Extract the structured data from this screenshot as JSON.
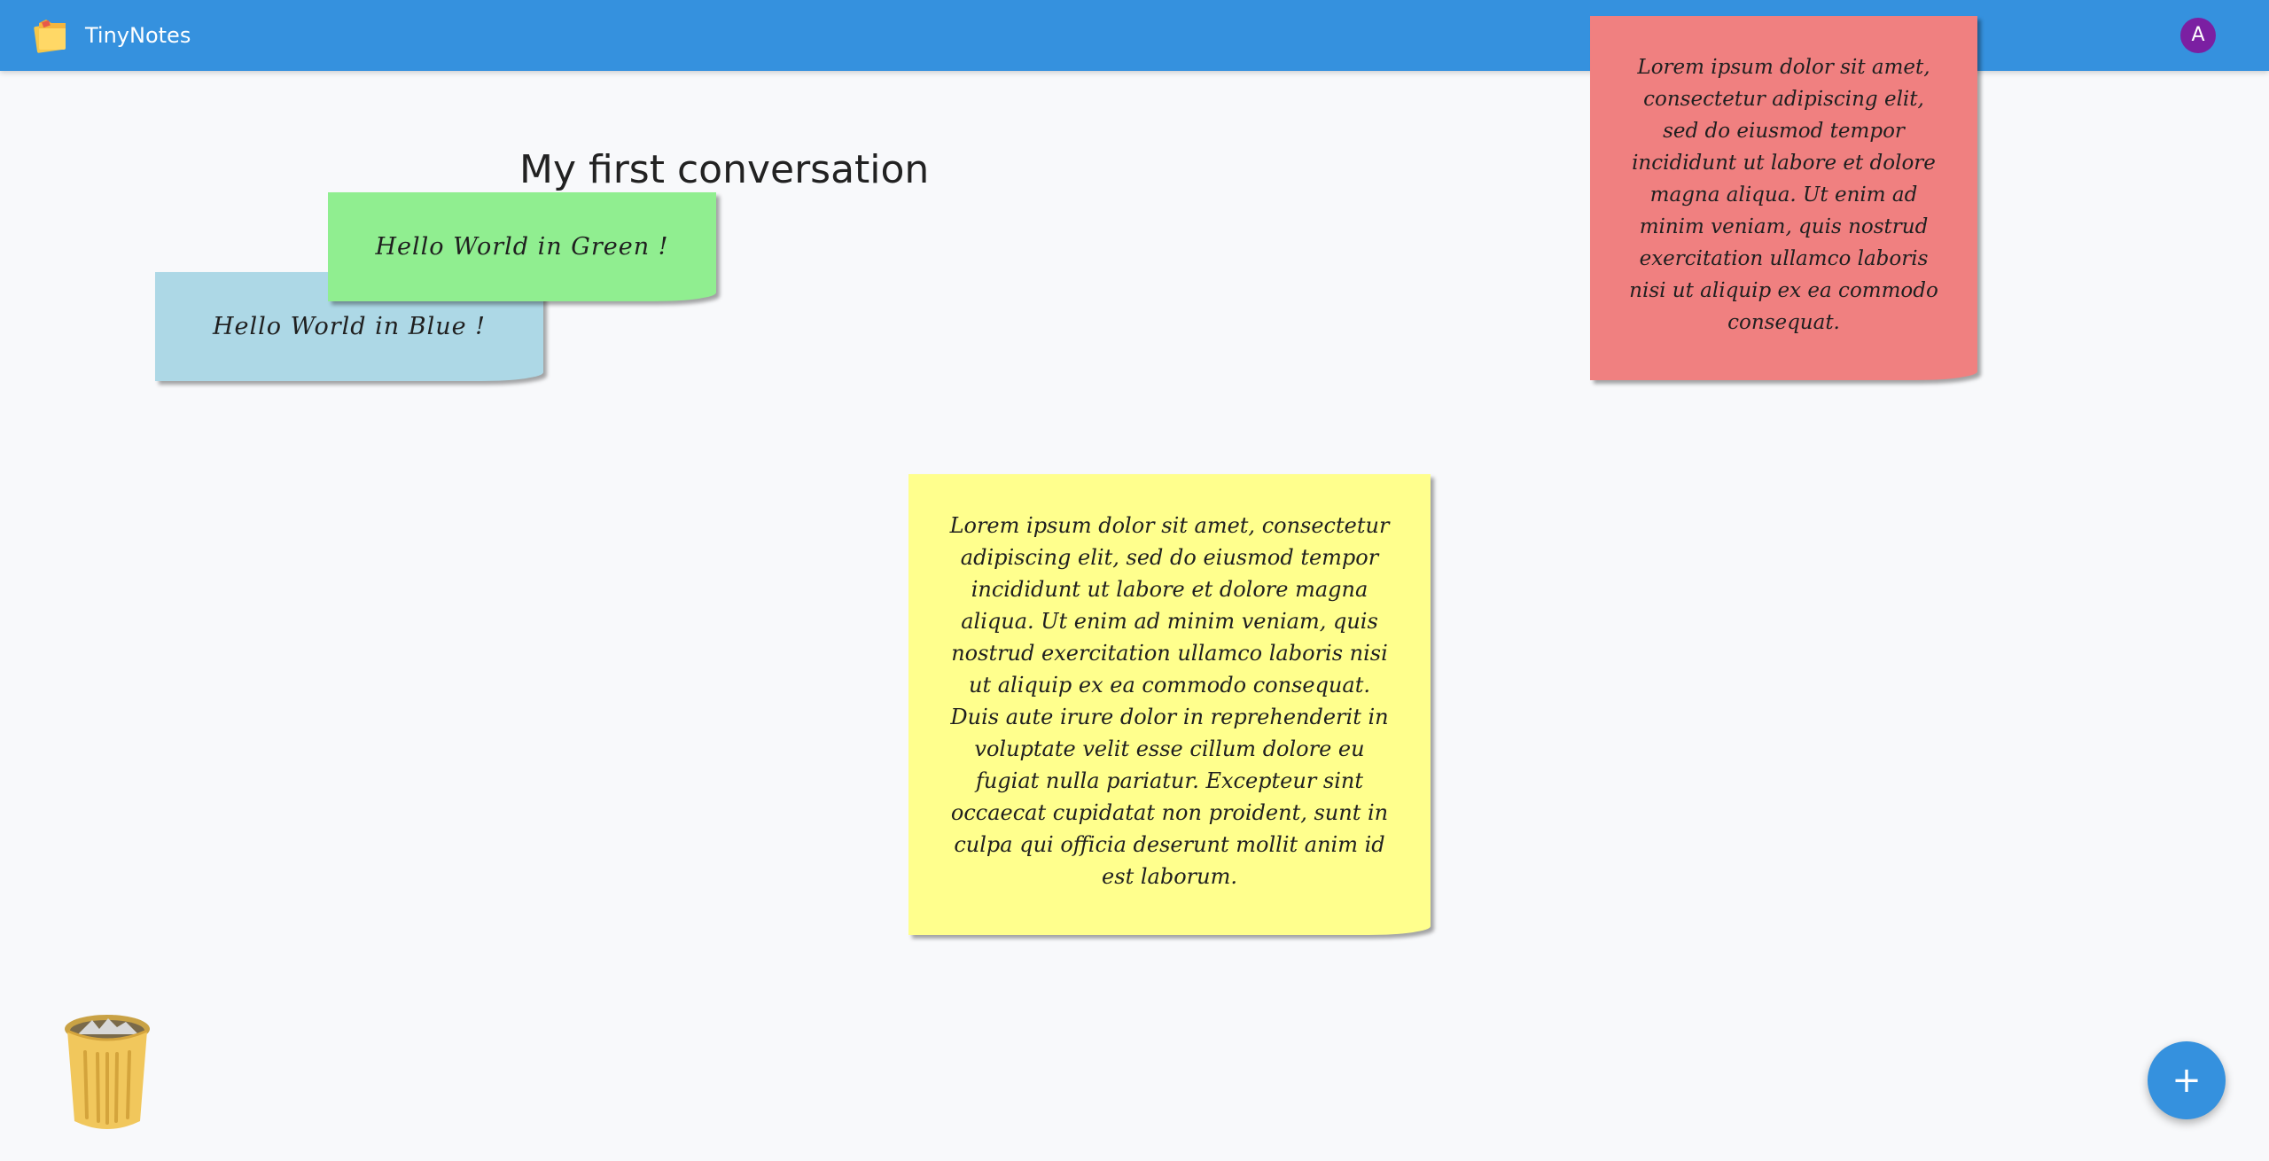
{
  "app": {
    "title": "TinyNotes",
    "logo_icon": "sticky-notes-icon",
    "header_color": "#3591de"
  },
  "user": {
    "avatar_initial": "A",
    "avatar_color": "#7b1fa2"
  },
  "conversation": {
    "title": "My first conversation"
  },
  "notes": [
    {
      "id": "green",
      "color": "#90ee90",
      "text": "Hello World in Green !"
    },
    {
      "id": "blue",
      "color": "#add8e6",
      "text": "Hello World in Blue !"
    },
    {
      "id": "red",
      "color": "#f08080",
      "text": "Lorem ipsum dolor sit amet, consectetur adipiscing elit, sed do eiusmod tempor incididunt ut labore et dolore magna aliqua. Ut enim ad minim veniam, quis nostrud exercitation ullamco laboris nisi ut aliquip ex ea commodo consequat."
    },
    {
      "id": "yellow",
      "color": "#ffff8d",
      "text": "Lorem ipsum dolor sit amet, consectetur adipiscing elit, sed do eiusmod tempor incididunt ut labore et dolore magna aliqua. Ut enim ad minim veniam, quis nostrud exercitation ullamco laboris nisi ut aliquip ex ea commodo consequat. Duis aute irure dolor in reprehenderit in voluptate velit esse cillum dolore eu fugiat nulla pariatur. Excepteur sint occaecat cupidatat non proident, sunt in culpa qui officia deserunt mollit anim id est laborum."
    }
  ],
  "trash": {
    "icon": "trash-can-icon"
  },
  "fab": {
    "label": "+",
    "icon": "plus-icon"
  }
}
